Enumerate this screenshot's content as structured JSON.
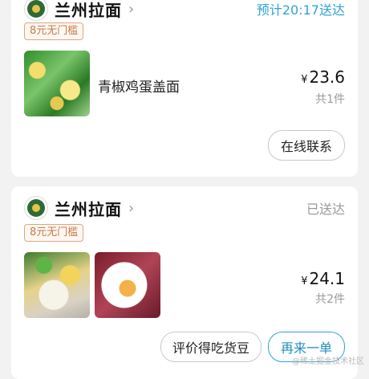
{
  "orders": [
    {
      "shop_name": "兰州拉面",
      "status": "预计20:17送达",
      "badge": "8元无门槛",
      "dish_name": "青椒鸡蛋盖面",
      "currency": "¥",
      "price": "23.6",
      "count": "共1件",
      "buttons": [
        "在线联系"
      ]
    },
    {
      "shop_name": "兰州拉面",
      "status": "已送达",
      "badge": "8元无门槛",
      "currency": "¥",
      "price": "24.1",
      "count": "共2件",
      "buttons": [
        "评价得吃货豆",
        "再来一单"
      ]
    }
  ],
  "watermark": "@稀土掘金技术社区",
  "colors": {
    "accent": "#2fa3d8",
    "badge": "#c77a4a",
    "background": "#f2f2f2"
  },
  "icons": [
    "shop-logo-icon",
    "chevron-right-icon"
  ]
}
